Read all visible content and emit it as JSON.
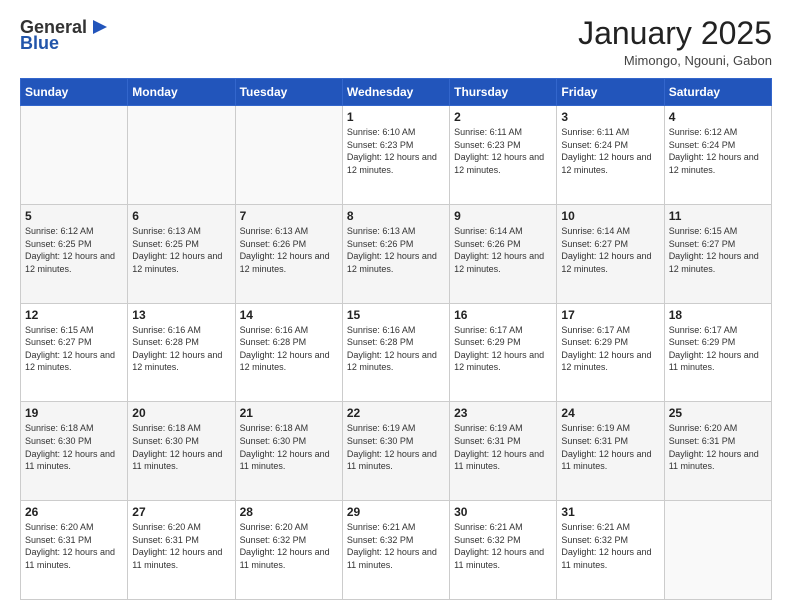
{
  "logo": {
    "general": "General",
    "blue": "Blue"
  },
  "header": {
    "month": "January 2025",
    "location": "Mimongo, Ngouni, Gabon"
  },
  "weekdays": [
    "Sunday",
    "Monday",
    "Tuesday",
    "Wednesday",
    "Thursday",
    "Friday",
    "Saturday"
  ],
  "weeks": [
    [
      {
        "day": "",
        "info": ""
      },
      {
        "day": "",
        "info": ""
      },
      {
        "day": "",
        "info": ""
      },
      {
        "day": "1",
        "info": "Sunrise: 6:10 AM\nSunset: 6:23 PM\nDaylight: 12 hours and 12 minutes."
      },
      {
        "day": "2",
        "info": "Sunrise: 6:11 AM\nSunset: 6:23 PM\nDaylight: 12 hours and 12 minutes."
      },
      {
        "day": "3",
        "info": "Sunrise: 6:11 AM\nSunset: 6:24 PM\nDaylight: 12 hours and 12 minutes."
      },
      {
        "day": "4",
        "info": "Sunrise: 6:12 AM\nSunset: 6:24 PM\nDaylight: 12 hours and 12 minutes."
      }
    ],
    [
      {
        "day": "5",
        "info": "Sunrise: 6:12 AM\nSunset: 6:25 PM\nDaylight: 12 hours and 12 minutes."
      },
      {
        "day": "6",
        "info": "Sunrise: 6:13 AM\nSunset: 6:25 PM\nDaylight: 12 hours and 12 minutes."
      },
      {
        "day": "7",
        "info": "Sunrise: 6:13 AM\nSunset: 6:26 PM\nDaylight: 12 hours and 12 minutes."
      },
      {
        "day": "8",
        "info": "Sunrise: 6:13 AM\nSunset: 6:26 PM\nDaylight: 12 hours and 12 minutes."
      },
      {
        "day": "9",
        "info": "Sunrise: 6:14 AM\nSunset: 6:26 PM\nDaylight: 12 hours and 12 minutes."
      },
      {
        "day": "10",
        "info": "Sunrise: 6:14 AM\nSunset: 6:27 PM\nDaylight: 12 hours and 12 minutes."
      },
      {
        "day": "11",
        "info": "Sunrise: 6:15 AM\nSunset: 6:27 PM\nDaylight: 12 hours and 12 minutes."
      }
    ],
    [
      {
        "day": "12",
        "info": "Sunrise: 6:15 AM\nSunset: 6:27 PM\nDaylight: 12 hours and 12 minutes."
      },
      {
        "day": "13",
        "info": "Sunrise: 6:16 AM\nSunset: 6:28 PM\nDaylight: 12 hours and 12 minutes."
      },
      {
        "day": "14",
        "info": "Sunrise: 6:16 AM\nSunset: 6:28 PM\nDaylight: 12 hours and 12 minutes."
      },
      {
        "day": "15",
        "info": "Sunrise: 6:16 AM\nSunset: 6:28 PM\nDaylight: 12 hours and 12 minutes."
      },
      {
        "day": "16",
        "info": "Sunrise: 6:17 AM\nSunset: 6:29 PM\nDaylight: 12 hours and 12 minutes."
      },
      {
        "day": "17",
        "info": "Sunrise: 6:17 AM\nSunset: 6:29 PM\nDaylight: 12 hours and 12 minutes."
      },
      {
        "day": "18",
        "info": "Sunrise: 6:17 AM\nSunset: 6:29 PM\nDaylight: 12 hours and 11 minutes."
      }
    ],
    [
      {
        "day": "19",
        "info": "Sunrise: 6:18 AM\nSunset: 6:30 PM\nDaylight: 12 hours and 11 minutes."
      },
      {
        "day": "20",
        "info": "Sunrise: 6:18 AM\nSunset: 6:30 PM\nDaylight: 12 hours and 11 minutes."
      },
      {
        "day": "21",
        "info": "Sunrise: 6:18 AM\nSunset: 6:30 PM\nDaylight: 12 hours and 11 minutes."
      },
      {
        "day": "22",
        "info": "Sunrise: 6:19 AM\nSunset: 6:30 PM\nDaylight: 12 hours and 11 minutes."
      },
      {
        "day": "23",
        "info": "Sunrise: 6:19 AM\nSunset: 6:31 PM\nDaylight: 12 hours and 11 minutes."
      },
      {
        "day": "24",
        "info": "Sunrise: 6:19 AM\nSunset: 6:31 PM\nDaylight: 12 hours and 11 minutes."
      },
      {
        "day": "25",
        "info": "Sunrise: 6:20 AM\nSunset: 6:31 PM\nDaylight: 12 hours and 11 minutes."
      }
    ],
    [
      {
        "day": "26",
        "info": "Sunrise: 6:20 AM\nSunset: 6:31 PM\nDaylight: 12 hours and 11 minutes."
      },
      {
        "day": "27",
        "info": "Sunrise: 6:20 AM\nSunset: 6:31 PM\nDaylight: 12 hours and 11 minutes."
      },
      {
        "day": "28",
        "info": "Sunrise: 6:20 AM\nSunset: 6:32 PM\nDaylight: 12 hours and 11 minutes."
      },
      {
        "day": "29",
        "info": "Sunrise: 6:21 AM\nSunset: 6:32 PM\nDaylight: 12 hours and 11 minutes."
      },
      {
        "day": "30",
        "info": "Sunrise: 6:21 AM\nSunset: 6:32 PM\nDaylight: 12 hours and 11 minutes."
      },
      {
        "day": "31",
        "info": "Sunrise: 6:21 AM\nSunset: 6:32 PM\nDaylight: 12 hours and 11 minutes."
      },
      {
        "day": "",
        "info": ""
      }
    ]
  ]
}
